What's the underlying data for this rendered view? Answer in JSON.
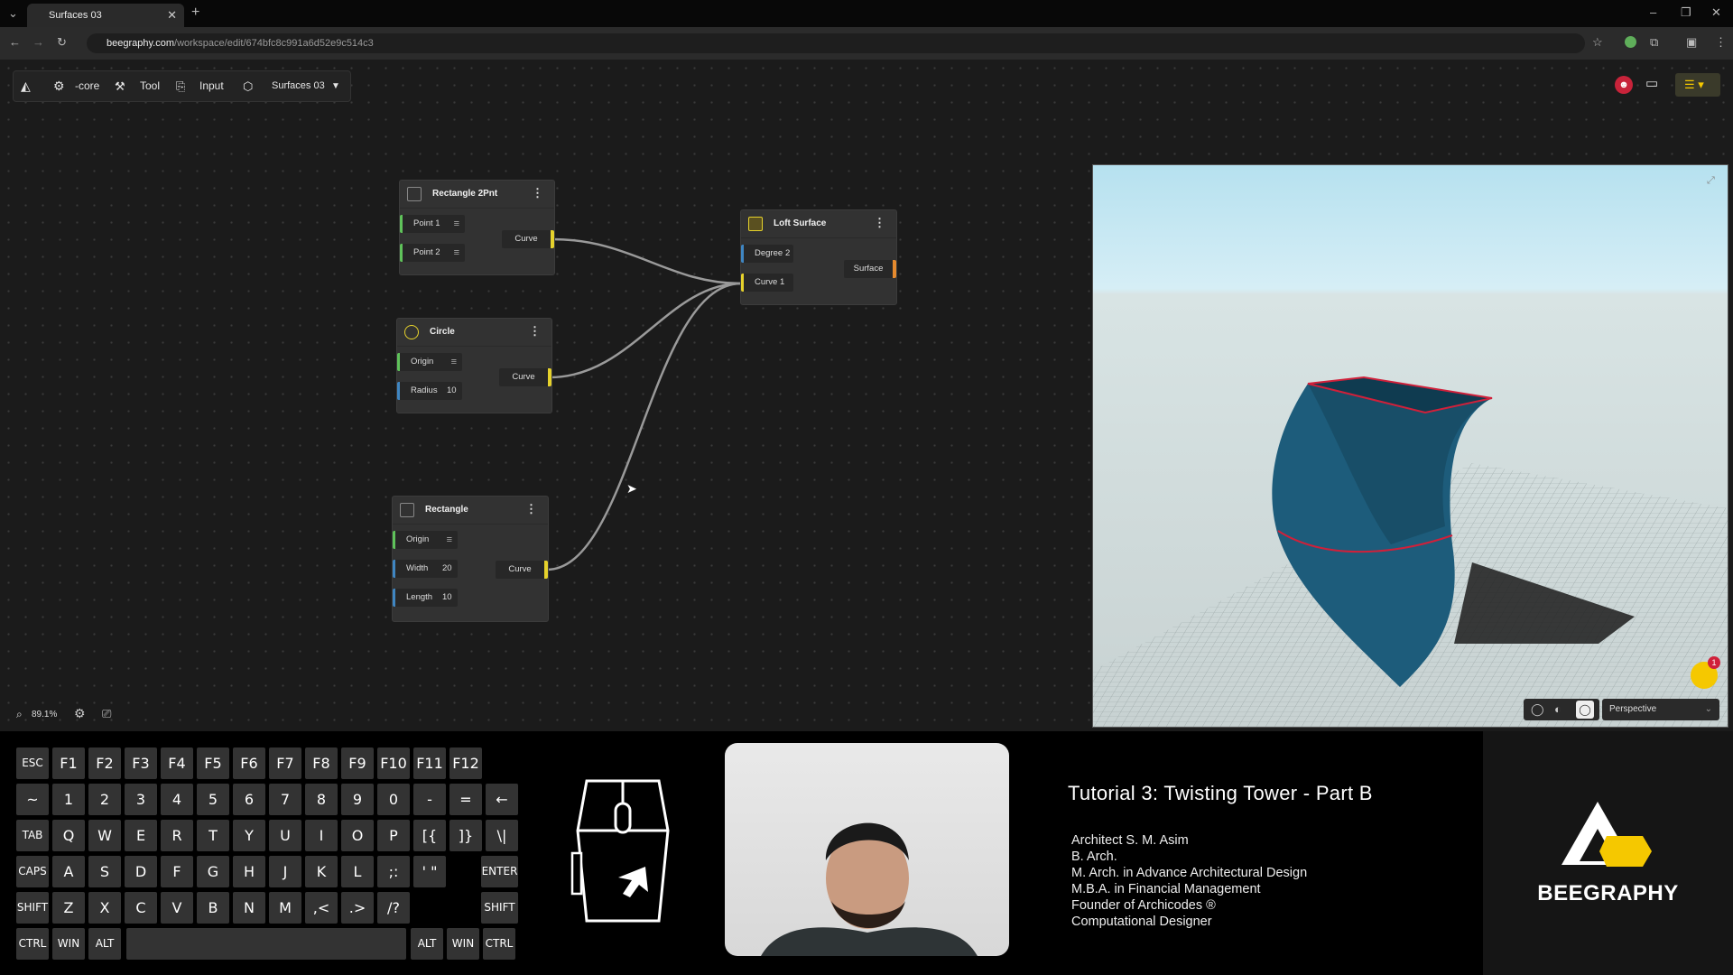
{
  "browser": {
    "tab_title": "Surfaces 03",
    "tab_close": "✕",
    "new_tab": "+",
    "url_domain": "beegraphy.com",
    "url_path": "/workspace/edit/674bfc8c991a6d52e9c514c3",
    "window_controls": [
      "–",
      "❐",
      "✕"
    ]
  },
  "toolbar": {
    "core_label": "-core",
    "tool_label": "Tool",
    "input_label": "Input",
    "file_label": "Surfaces 03"
  },
  "zoom": {
    "value": "89.1%"
  },
  "nodes": {
    "rect2pt": {
      "title": "Rectangle 2Pnt",
      "in1": "Point 1",
      "in2": "Point 2",
      "out": "Curve"
    },
    "circle": {
      "title": "Circle",
      "in1": "Origin",
      "in2": "Radius",
      "in2_val": "10",
      "out": "Curve"
    },
    "rectangle": {
      "title": "Rectangle",
      "in1": "Origin",
      "in2": "Width",
      "in2_val": "20",
      "in3": "Length",
      "in3_val": "10",
      "out": "Curve"
    },
    "loft": {
      "title": "Loft Surface",
      "in1": "Degree",
      "in1_val": "2",
      "in2": "Curve 1",
      "out": "Surface"
    }
  },
  "viewport": {
    "camera": "Perspective",
    "notification_count": "1"
  },
  "keyboard": {
    "row1": [
      "ESC",
      "F1",
      "F2",
      "F3",
      "F4",
      "F5",
      "F6",
      "F7",
      "F8",
      "F9",
      "F10",
      "F11",
      "F12"
    ],
    "row2": [
      "~",
      "1",
      "2",
      "3",
      "4",
      "5",
      "6",
      "7",
      "8",
      "9",
      "0",
      "-",
      "=",
      "←"
    ],
    "row3": [
      "TAB",
      "Q",
      "W",
      "E",
      "R",
      "T",
      "Y",
      "U",
      "I",
      "O",
      "P",
      "[{",
      "]}",
      "\\|"
    ],
    "row4": [
      "CAPS",
      "A",
      "S",
      "D",
      "F",
      "G",
      "H",
      "J",
      "K",
      "L",
      ";:",
      "' \"",
      "ENTER"
    ],
    "row5": [
      "SHIFT",
      "Z",
      "X",
      "C",
      "V",
      "B",
      "N",
      "M",
      ",<",
      ".>",
      "/?",
      "SHIFT"
    ],
    "row6": [
      "CTRL",
      "WIN",
      "ALT",
      "ALT",
      "WIN",
      "CTRL"
    ]
  },
  "tutorial": {
    "title": "Tutorial 3: Twisting Tower - Part B",
    "credits": [
      "Architect S. M. Asim",
      "B. Arch.",
      "M. Arch. in Advance Architectural Design",
      "M.B.A. in Financial Management",
      "Founder of Archicodes ®",
      "Computational Designer"
    ]
  },
  "brand": {
    "name": "BEEGRAPHY",
    "accent": "#f5c800"
  },
  "colors": {
    "point_port": "#5fc25a",
    "number_port": "#3f86c2",
    "curve_port": "#e6d22c",
    "surface_port": "#e58a2e",
    "model": "#1b5a78",
    "model_edge": "#d0203a"
  }
}
